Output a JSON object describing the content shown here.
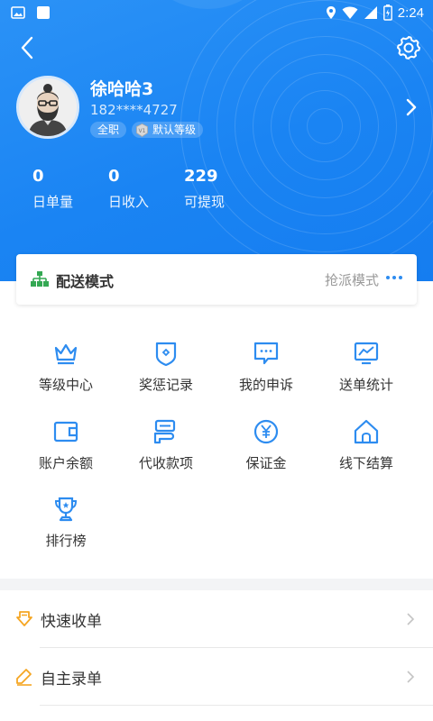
{
  "status_bar": {
    "time": "2:24"
  },
  "profile": {
    "name": "徐哈哈3",
    "phone": "182****4727",
    "job_type": "全职",
    "level": "默认等级"
  },
  "stats": [
    {
      "value": "0",
      "label": "日单量"
    },
    {
      "value": "0",
      "label": "日收入"
    },
    {
      "value": "229",
      "label": "可提现"
    }
  ],
  "delivery_mode": {
    "title": "配送模式",
    "value": "抢派模式"
  },
  "menu": [
    {
      "label": "等级中心",
      "icon": "crown-icon"
    },
    {
      "label": "奖惩记录",
      "icon": "shield-badge-icon"
    },
    {
      "label": "我的申诉",
      "icon": "chat-bubble-icon"
    },
    {
      "label": "送单统计",
      "icon": "chart-monitor-icon"
    },
    {
      "label": "账户余额",
      "icon": "wallet-icon"
    },
    {
      "label": "代收款项",
      "icon": "card-collect-icon"
    },
    {
      "label": "保证金",
      "icon": "yen-coin-icon"
    },
    {
      "label": "线下结算",
      "icon": "house-icon"
    },
    {
      "label": "排行榜",
      "icon": "trophy-icon"
    }
  ],
  "list": [
    {
      "label": "快速收单",
      "icon": "download-order-icon",
      "icon_color": "#f5a623"
    },
    {
      "label": "自主录单",
      "icon": "pencil-icon",
      "icon_color": "#f5a623"
    }
  ],
  "colors": {
    "primary": "#1a84f3",
    "icon_blue": "#2d8cf0",
    "accent_orange": "#f5a623",
    "mode_icon_green": "#34a853"
  }
}
